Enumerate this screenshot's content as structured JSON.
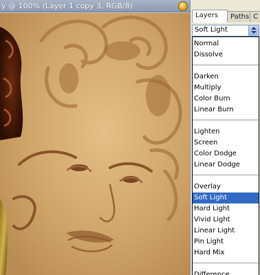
{
  "document": {
    "title": "y @ 100% (Layer 1 copy 3, RGB/8)"
  },
  "panel": {
    "tabs": [
      {
        "label": "Layers",
        "active": true
      },
      {
        "label": "Paths",
        "active": false
      },
      {
        "label": "C",
        "active": false
      }
    ],
    "blend_mode_selected": "Soft Light",
    "blend_modes": [
      "Normal",
      "Dissolve",
      "Darken",
      "Multiply",
      "Color Burn",
      "Linear Burn",
      "Lighten",
      "Screen",
      "Color Dodge",
      "Linear Dodge",
      "Overlay",
      "Soft Light",
      "Hard Light",
      "Vivid Light",
      "Linear Light",
      "Pin Light",
      "Hard Mix",
      "Difference"
    ]
  },
  "colors": {
    "canvas_tone": "#c99e62",
    "selection": "#316ac5"
  }
}
